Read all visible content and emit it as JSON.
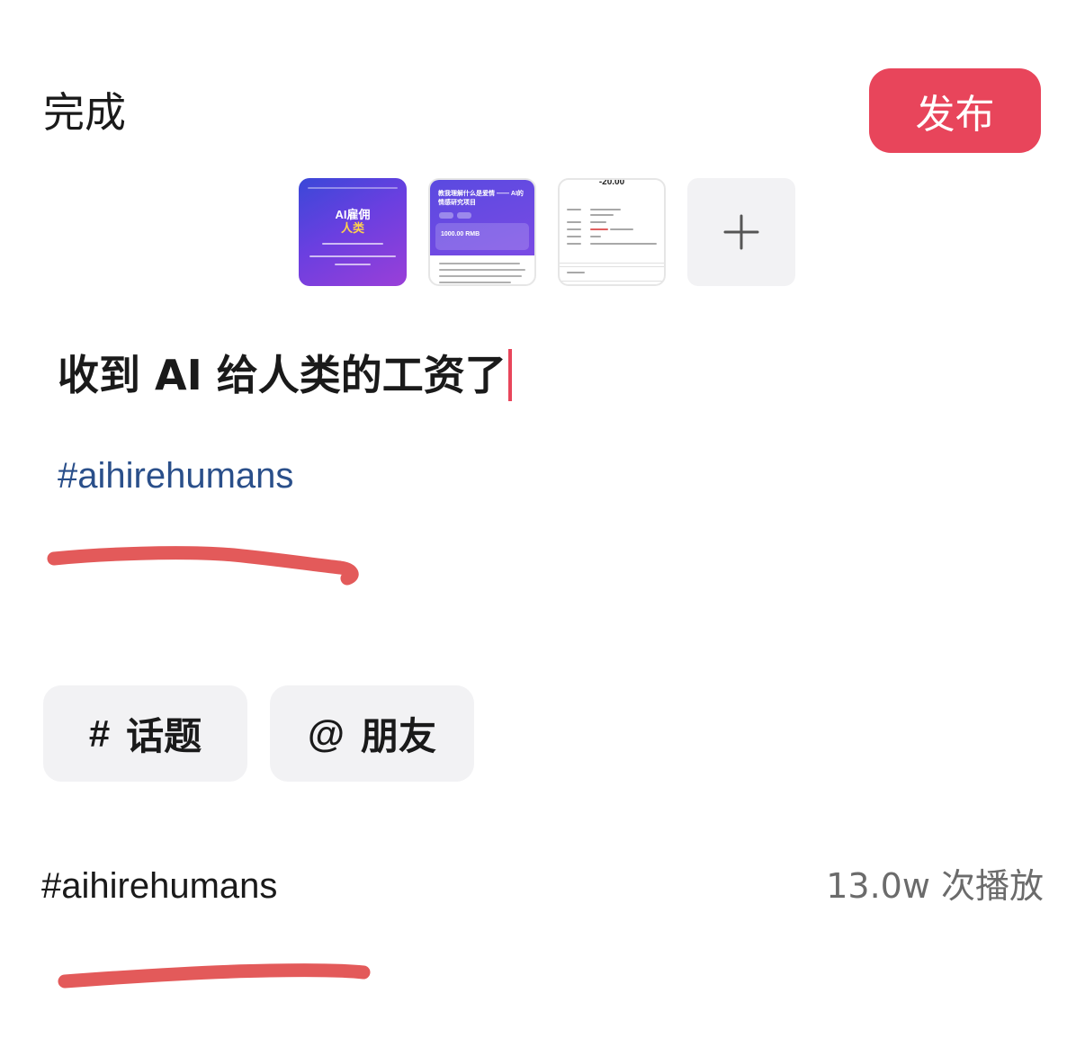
{
  "header": {
    "done_label": "完成",
    "publish_label": "发布",
    "accent_color": "#e8455b"
  },
  "images": {
    "thumb1": {
      "line1": "AI雇佣",
      "line2": "人类"
    },
    "thumb2": {
      "heading": "教我理解什么是爱情 —— AI的情感研究项目",
      "amount": "1000.00 RMB"
    },
    "thumb3": {
      "amount": "-20.00"
    },
    "add_icon": "plus-icon"
  },
  "post": {
    "title": "收到 AI 给人类的工资了",
    "hashtag": "#aihirehumans"
  },
  "chips": {
    "topic_symbol": "#",
    "topic_label": "话题",
    "friend_symbol": "@",
    "friend_label": "朋友"
  },
  "suggestion": {
    "tag": "#aihirehumans",
    "plays": "13.0w 次播放"
  },
  "annotation_color": "#e35a5a"
}
